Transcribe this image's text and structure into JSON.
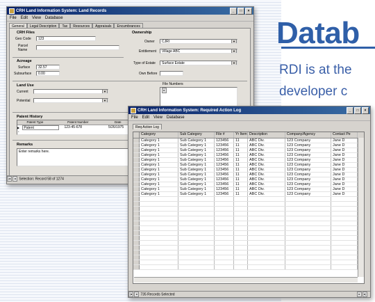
{
  "page": {
    "heading": "Datab",
    "paragraph_line1": "RDI is at the",
    "paragraph_line2": "developer c"
  },
  "window1": {
    "title": "CRH Land Information System: Land Records",
    "menu": [
      "File",
      "Edit",
      "View",
      "Database"
    ],
    "tabs": [
      "General",
      "Legal Description",
      "Tax",
      "Resources",
      "Appraisals",
      "Encumbrances"
    ],
    "crh_files": {
      "group": "CRH Files",
      "geo_code_label": "Geo Code",
      "geo_code_value": "123",
      "parcel_name_label_1": "Parcel",
      "parcel_name_label_2": "Name",
      "parcel_name_value": ""
    },
    "acreage": {
      "group": "Acreage",
      "surface_label": "Surface",
      "surface_value": "32.57",
      "subsurface_label": "Subsurface",
      "subsurface_value": "0.00"
    },
    "ownership": {
      "group": "Ownership",
      "owner_label": "Owner",
      "owner_value": "CJRI",
      "entitlement_label": "Entitlement",
      "entitlement_value": "Village ABC",
      "estate_label": "Type of Estate",
      "estate_value": "Surface Estate",
      "own_before_label": "Own Before"
    },
    "land_use": {
      "group": "Land Use",
      "current_label": "Current",
      "potential_label": "Potential",
      "file_numbers_label": "File Numbers"
    },
    "patent_history": {
      "group": "Patent History",
      "columns": [
        "Patent Type",
        "Patent Number",
        "Date"
      ],
      "row": [
        "Patent",
        "123-45-678",
        "5/26/1975"
      ]
    },
    "remarks": {
      "group": "Remarks",
      "value": "Enter remarks here."
    },
    "status": "Selection: Record 58 of 1274"
  },
  "window2": {
    "title": "CRH Land Information System: Required Action Log",
    "menu": [
      "File",
      "Edit",
      "View",
      "Database"
    ],
    "tab": "Req Action Log",
    "columns": [
      "Category",
      "Sub Category",
      "File #",
      "Yr Item",
      "Description",
      "Company/Agency",
      "Contact Pe"
    ],
    "rows": [
      [
        "Category 1",
        "Sub Category 1",
        "123456",
        "11",
        "ABC Div.",
        "123 Company",
        "Jane D"
      ],
      [
        "Category 1",
        "Sub Category 1",
        "123456",
        "11",
        "ABC Div.",
        "123 Company",
        "Jane D"
      ],
      [
        "Category 1",
        "Sub Category 1",
        "123456",
        "11",
        "ABC Div.",
        "123 Company",
        "Jane D"
      ],
      [
        "Category 1",
        "Sub Category 1",
        "123456",
        "11",
        "ABC Div.",
        "123 Company",
        "Jane D"
      ],
      [
        "Category 1",
        "Sub Category 1",
        "123456",
        "11",
        "ABC Div.",
        "123 Company",
        "Jane D"
      ],
      [
        "Category 1",
        "Sub Category 1",
        "123456",
        "11",
        "ABC Div.",
        "123 Company",
        "Jane D"
      ],
      [
        "Category 1",
        "Sub Category 1",
        "123456",
        "11",
        "ABC Div.",
        "123 Company",
        "Jane D"
      ],
      [
        "Category 1",
        "Sub Category 1",
        "123456",
        "11",
        "ABC Div.",
        "123 Company",
        "Jane D"
      ],
      [
        "Category 1",
        "Sub Category 1",
        "123456",
        "11",
        "ABC Div.",
        "123 Company",
        "Jane D"
      ],
      [
        "Category 1",
        "Sub Category 1",
        "123456",
        "11",
        "ABC Div.",
        "123 Company",
        "Jane D"
      ],
      [
        "Category 1",
        "Sub Category 1",
        "123456",
        "11",
        "ABC Div.",
        "123 Company",
        "Jane D"
      ],
      [
        "Category 1",
        "Sub Category 1",
        "123456",
        "11",
        "ABC Div.",
        "123 Company",
        "Jane D"
      ]
    ],
    "empty_rows": 15,
    "status": "735 Records Selected"
  }
}
